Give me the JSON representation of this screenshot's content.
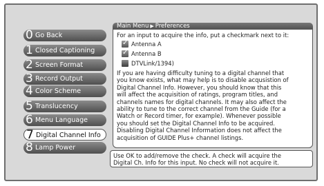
{
  "breadcrumb": {
    "root": "Main Menu",
    "current": "Preferences"
  },
  "menu": [
    {
      "num": "0",
      "label": "Go Back"
    },
    {
      "num": "1",
      "label": "Closed Captioning"
    },
    {
      "num": "2",
      "label": "Screen Format"
    },
    {
      "num": "3",
      "label": "Record Output"
    },
    {
      "num": "4",
      "label": "Color Scheme"
    },
    {
      "num": "5",
      "label": "Translucency"
    },
    {
      "num": "6",
      "label": "Menu Language"
    },
    {
      "num": "7",
      "label": "Digital Channel Info"
    },
    {
      "num": "8",
      "label": "Lamp Power"
    }
  ],
  "content": {
    "intro": "For an input to acquire the info, put a checkmark next to it:",
    "options": [
      {
        "label": "Antenna A",
        "checked": true
      },
      {
        "label": "Antenna B",
        "checked": true
      },
      {
        "label": "DTVLink/1394)",
        "checked": false
      }
    ],
    "body_lines": [
      "If you are having difficulty tuning to a digital channel that",
      "you know exists, what may help is to disable acqusistion of",
      "Digital Channel Info. However, you should know that this",
      "will affect the acquisition of ratings, program titles, and",
      "channels names for digital channels. It may also affect the",
      "ability to tune to the correct channel from the Guide (for a",
      "Watch or Record timer, for example). Whenever possible",
      "you should set the Digital Channel Info to be acquired.",
      "Disabling Digital Channel Information does not affect the",
      "acquisition of GUIDE Plus+ channel listings."
    ]
  },
  "help": {
    "lines": [
      "Use OK to add/remove the check. A check will acquire the",
      "Digital Ch. Info for this input. No check will not acquire it."
    ]
  },
  "colors": {
    "frame": "#d9d9d9",
    "button": "#5a5a5a",
    "selected": "#ffffff",
    "checkbox": "#666666"
  }
}
